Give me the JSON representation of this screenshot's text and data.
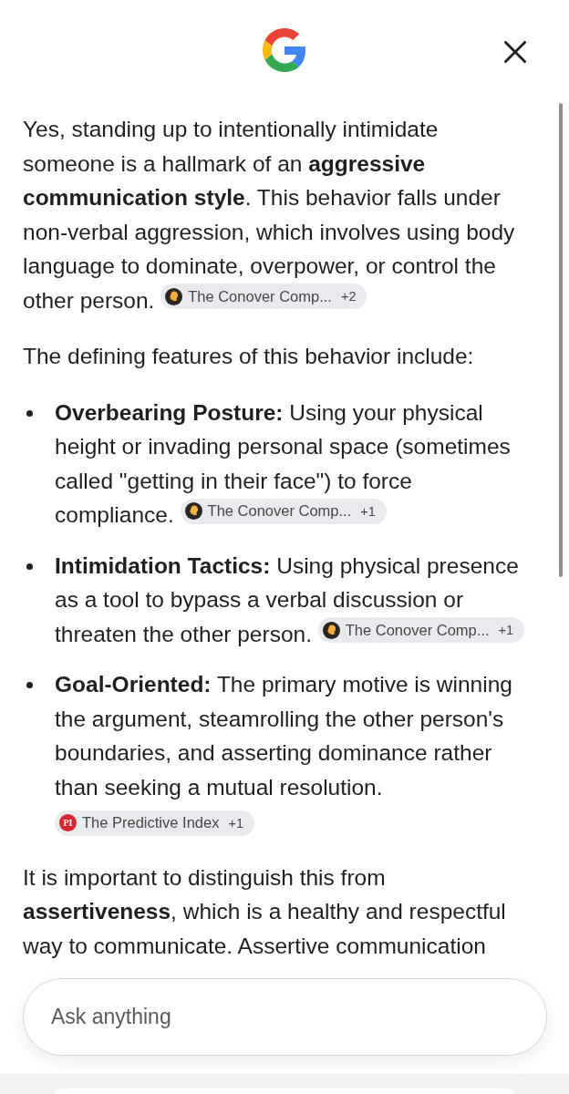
{
  "answer": {
    "blocks": [
      {
        "kind": "paragraph",
        "text": "Yes, standing up to intentionally intimidate someone is a hallmark of an **aggressive communication style**. This behavior falls under non-verbal aggression, which involves using body language to dominate, overpower, or control the other person.",
        "sources": {
          "kind": "head",
          "label": "The Conover Comp...",
          "more": "+2"
        }
      },
      {
        "kind": "paragraph",
        "text": "The defining features of this behavior include:"
      },
      {
        "kind": "list",
        "items": [
          {
            "text": "**Overbearing Posture:** Using your physical height or invading personal space (sometimes called \"getting in their face\") to force compliance.",
            "sources": {
              "kind": "head",
              "label": "The Conover Comp...",
              "more": "+1"
            }
          },
          {
            "text": "**Intimidation Tactics:** Using physical presence as a tool to bypass a verbal discussion or threaten the other person.",
            "sources": {
              "kind": "head",
              "label": "The Conover Comp...",
              "more": "+1"
            }
          },
          {
            "text": "**Goal-Oriented:** The primary motive is winning the argument, steamrolling the other person's boundaries, and asserting dominance rather than seeking a mutual resolution.",
            "sources": {
              "kind": "monogram",
              "monogram": "PI",
              "label": "The Predictive Index",
              "more": "+1"
            }
          }
        ]
      },
      {
        "kind": "paragraph",
        "text": "It is important to distinguish this from **assertiveness**, which is a healthy and respectful way to communicate. Assertive communication"
      }
    ]
  },
  "input": {
    "placeholder": "Ask anything"
  }
}
